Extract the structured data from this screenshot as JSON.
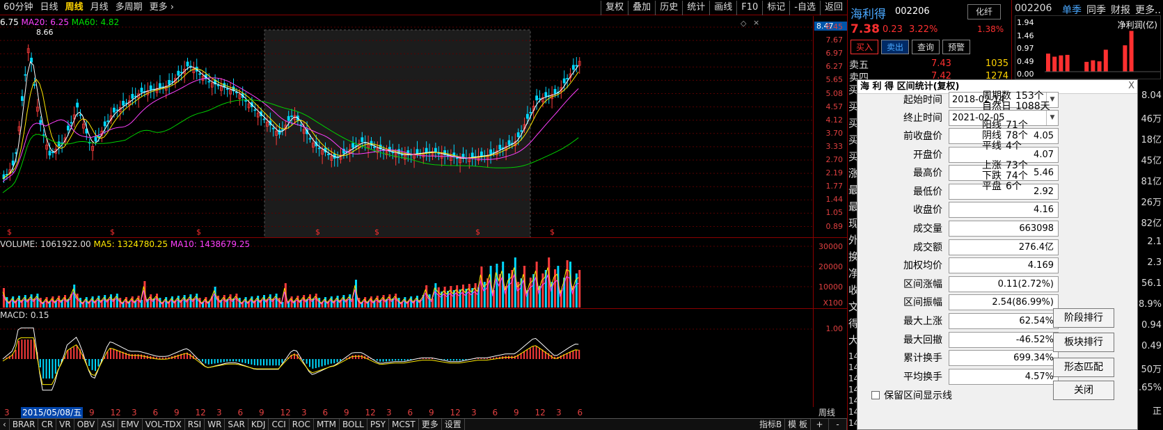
{
  "toolbar": {
    "left": [
      "60分钟",
      "日线",
      "周线",
      "月线",
      "多周期",
      "更多"
    ],
    "right": [
      "复权",
      "叠加",
      "历史",
      "统计",
      "画线",
      "F10",
      "标记",
      "-自选",
      "返回"
    ]
  },
  "main": {
    "ma_line": {
      "ma_first": "6.75",
      "ma20": "MA20: 6.25",
      "ma60": "MA60: 4.82"
    },
    "peak_label": "8.66",
    "price_top_label": "8.47",
    "yticks": [
      "8.45",
      "7.67",
      "6.97",
      "6.27",
      "5.65",
      "5.08",
      "4.57",
      "4.12",
      "3.70",
      "3.33",
      "2.70",
      "2.19",
      "1.77",
      "1.44",
      "1.05",
      "0.89"
    ]
  },
  "volume": {
    "title": "VOLUME: 1061922.00",
    "ma5": "MA5: 1324780.25",
    "ma10": "MA10: 1438679.25",
    "yticks": [
      "30000",
      "20000",
      "10000",
      "X100"
    ]
  },
  "macd": {
    "title": "MACD: 0.15",
    "ytick": "1.00"
  },
  "xaxis": {
    "labels": [
      "3",
      "12",
      "3",
      "6",
      "9",
      "12",
      "3",
      "6",
      "9",
      "12",
      "3",
      "6",
      "9",
      "12",
      "3",
      "6",
      "9",
      "12",
      "3",
      "6",
      "9",
      "12",
      "3",
      "6",
      "9",
      "12",
      "3",
      "6",
      "9",
      "12"
    ],
    "cursor_date": "2015/05/08/五",
    "period": "周线"
  },
  "bottom_tabs": [
    "BRAR",
    "CR",
    "VR",
    "OBV",
    "ASI",
    "EMV",
    "VOL-TDX",
    "RSI",
    "WR",
    "SAR",
    "KDJ",
    "CCI",
    "ROC",
    "MTM",
    "BOLL",
    "PSY",
    "MCST",
    "更多",
    "设置"
  ],
  "bottom_right": [
    "指标B",
    "模 板",
    "+",
    "-"
  ],
  "quote": {
    "name": "海利得",
    "code": "002206",
    "tag": "化纤",
    "price": "7.38",
    "change": "0.23",
    "pct": "3.22%",
    "pct2": "1.38%",
    "buttons": [
      "买入",
      "卖出",
      "查询",
      "预警"
    ],
    "sell5_label": "卖五",
    "sell5_price": "7.43",
    "sell5_vol": "1035",
    "sell4_label": "卖四",
    "sell4_price": "7.42",
    "sell4_vol": "1274",
    "side_labels": [
      "买",
      "买",
      "买",
      "买",
      "买",
      "涨",
      "最",
      "最",
      "现",
      "外",
      "换",
      "净",
      "收",
      "文",
      "得",
      "大"
    ],
    "side_vals": [
      "14",
      "14",
      "14",
      "14",
      "14",
      "14",
      "14"
    ]
  },
  "fin": {
    "code": "002206",
    "tabs": [
      "单季",
      "同季",
      "财报",
      "更多.."
    ],
    "title": "净利润(亿)",
    "yticks": [
      "1.94",
      "1.46",
      "0.97",
      "0.49",
      "0.00"
    ],
    "bars": [
      0.7,
      0.58,
      0.63,
      0.65,
      0.0,
      0.0,
      0.38,
      0.44,
      0.4,
      0.85,
      0.0,
      0.0,
      1.02,
      1.58
    ],
    "side_vals": [
      "8.04",
      "46万",
      "18亿",
      "45亿",
      "81亿",
      "26万",
      "82亿",
      "2.1",
      "2.3",
      "56.1",
      "8.9%",
      "0.94",
      "0.49",
      "50万",
      ".65%",
      "正"
    ]
  },
  "dialog": {
    "title": "海 利 得 区间统计(复权)",
    "start_label": "起始时间",
    "start": "2018-02-14",
    "end_label": "终止时间",
    "end": "2021-02-05",
    "fields": [
      {
        "label": "前收盘价",
        "value": "4.05"
      },
      {
        "label": "开盘价",
        "value": "4.07"
      },
      {
        "label": "最高价",
        "value": "5.46"
      },
      {
        "label": "最低价",
        "value": "2.92"
      },
      {
        "label": "收盘价",
        "value": "4.16"
      },
      {
        "label": "成交量",
        "value": "663098"
      },
      {
        "label": "成交额",
        "value": "276.4亿"
      },
      {
        "label": "加权均价",
        "value": "4.169"
      },
      {
        "label": "区间涨幅",
        "value": "0.11(2.72%)"
      },
      {
        "label": "区间振幅",
        "value": "2.54(86.99%)"
      },
      {
        "label": "最大上涨",
        "value": "62.54%"
      },
      {
        "label": "最大回撤",
        "value": "-46.52%"
      },
      {
        "label": "累计换手",
        "value": "699.34%"
      },
      {
        "label": "平均换手",
        "value": "4.57%"
      }
    ],
    "stats": [
      {
        "label": "周期数",
        "value": "153个"
      },
      {
        "label": "自然日",
        "value": "1088天"
      },
      {
        "label": "阳线",
        "value": "71个"
      },
      {
        "label": "阴线",
        "value": "78个"
      },
      {
        "label": "平线",
        "value": "4个"
      },
      {
        "label": "上涨",
        "value": "73个"
      },
      {
        "label": "下跌",
        "value": "74个"
      },
      {
        "label": "平盘",
        "value": "6个"
      }
    ],
    "buttons": [
      "阶段排行",
      "板块排行",
      "形态匹配",
      "关闭"
    ],
    "checkbox_label": "保留区间显示线",
    "close_x": "X"
  }
}
